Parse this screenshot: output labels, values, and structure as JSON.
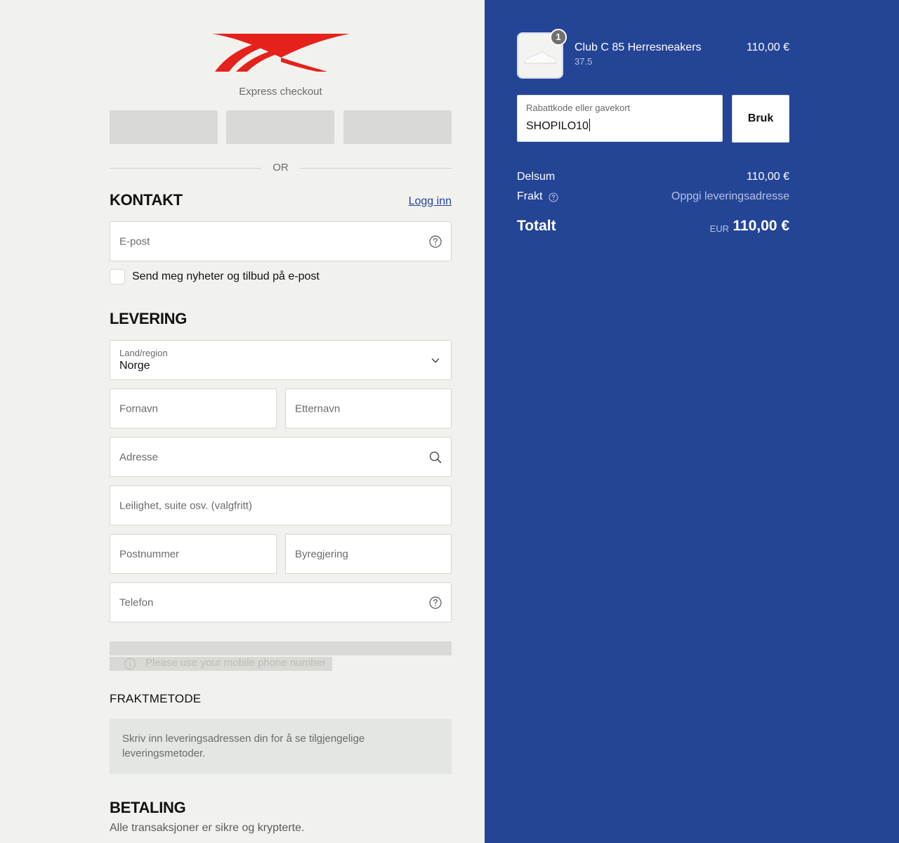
{
  "brand": {
    "logo_color": "#e4221b",
    "accent": "#244596",
    "logo_name": "Reebok"
  },
  "express": {
    "label": "Express checkout",
    "or_text": "OR"
  },
  "contact": {
    "title": "KONTAKT",
    "login_link": "Logg inn",
    "email_placeholder": "E-post",
    "newsletter_label": "Send meg nyheter og tilbud på e-post"
  },
  "delivery": {
    "title": "LEVERING",
    "country_label": "Land/region",
    "country_value": "Norge",
    "first_name_placeholder": "Fornavn",
    "last_name_placeholder": "Etternavn",
    "address_placeholder": "Adresse",
    "apartment_placeholder": "Leilighet, suite osv. (valgfritt)",
    "postal_placeholder": "Postnummer",
    "city_placeholder": "Byregjering",
    "phone_placeholder": "Telefon",
    "phone_notice": "Please use your mobile phone number"
  },
  "shipping": {
    "title": "FRAKTMETODE",
    "info": "Skriv inn leveringsadressen din for å se tilgjengelige leveringsmetoder."
  },
  "payment": {
    "title": "BETALING",
    "subtitle": "Alle transaksjoner er sikre og krypterte."
  },
  "cart": {
    "item": {
      "name": "Club C 85 Herresneakers",
      "size": "37.5",
      "price": "110,00 €",
      "quantity": "1"
    },
    "discount": {
      "label": "Rabattkode eller gavekort",
      "value": "SHOPILO10",
      "apply_label": "Bruk"
    },
    "subtotal_label": "Delsum",
    "subtotal_value": "110,00 €",
    "shipping_label": "Frakt",
    "shipping_value": "Oppgi leveringsadresse",
    "total_label": "Totalt",
    "total_currency": "EUR",
    "total_value": "110,00 €"
  }
}
